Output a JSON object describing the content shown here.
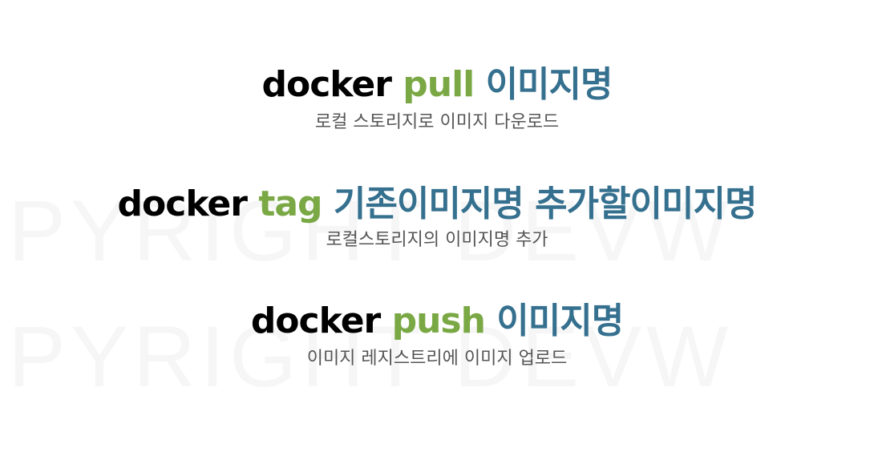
{
  "commands": [
    {
      "keyword": "docker",
      "verb": "pull",
      "args": "이미지명",
      "description": "로컬 스토리지로 이미지 다운로드"
    },
    {
      "keyword": "docker",
      "verb": "tag",
      "args": "기존이미지명 추가할이미지명",
      "description": "로컬스토리지의 이미지명 추가"
    },
    {
      "keyword": "docker",
      "verb": "push",
      "args": "이미지명",
      "description": "이미지 레지스트리에 이미지 업로드"
    }
  ],
  "colors": {
    "keyword": "#000000",
    "verb": "#7aa844",
    "args": "#35708f",
    "description": "#555555",
    "watermark": "#f6f6f6"
  }
}
